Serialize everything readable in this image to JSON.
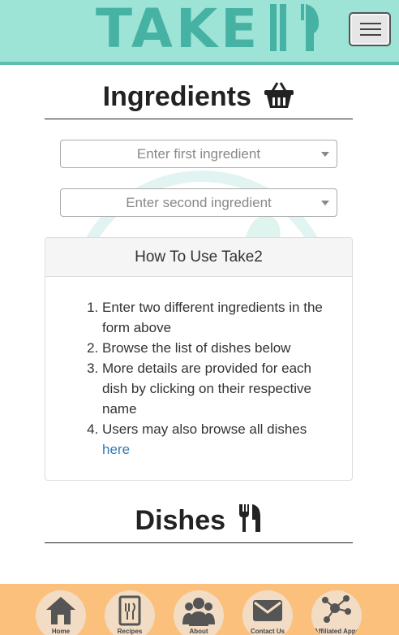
{
  "header": {
    "logo_text": "TAKE",
    "logo_icon": "fork-knife-icon",
    "menu_icon": "hamburger-icon"
  },
  "ingredients": {
    "title": "Ingredients",
    "title_icon": "basket-icon",
    "first_placeholder": "Enter first ingredient",
    "second_placeholder": "Enter second ingredient"
  },
  "howto": {
    "title": "How To Use Take2",
    "steps": [
      "Enter two different ingredients in the form above",
      "Browse the list of dishes below",
      "More details are provided for each dish by clicking on their respective name",
      "Users may also browse all dishes"
    ],
    "link_text": "here"
  },
  "dishes": {
    "title": "Dishes",
    "title_icon": "cutlery-icon"
  },
  "footer": {
    "items": [
      {
        "label": "Home",
        "icon": "house-icon"
      },
      {
        "label": "Recipes",
        "icon": "recipe-book-icon"
      },
      {
        "label": "About",
        "icon": "people-icon"
      },
      {
        "label": "Contact Us",
        "icon": "envelope-icon"
      },
      {
        "label": "Affiliated Apps",
        "icon": "share-network-icon"
      }
    ]
  },
  "colors": {
    "header_bg": "#9de3d6",
    "logo": "#45b2a3",
    "footer_bg": "#fcc07d",
    "link": "#337ab7"
  }
}
